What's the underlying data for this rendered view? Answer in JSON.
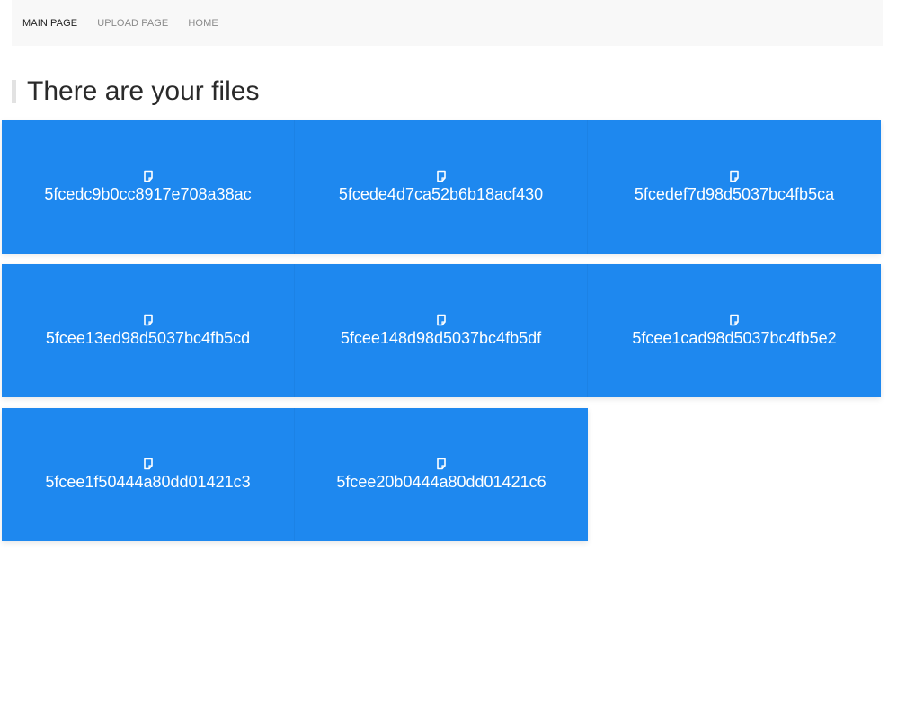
{
  "nav": {
    "items": [
      {
        "label": "MAIN PAGE",
        "active": true
      },
      {
        "label": "UPLOAD PAGE",
        "active": false
      },
      {
        "label": "HOME",
        "active": false
      }
    ]
  },
  "main": {
    "title": "There are your files"
  },
  "files": {
    "rows": [
      [
        {
          "name": "5fcedc9b0cc8917e708a38ac",
          "icon": "file-icon"
        },
        {
          "name": "5fcede4d7ca52b6b18acf430",
          "icon": "file-icon"
        },
        {
          "name": "5fcedef7d98d5037bc4fb5ca",
          "icon": "file-icon"
        }
      ],
      [
        {
          "name": "5fcee13ed98d5037bc4fb5cd",
          "icon": "file-icon"
        },
        {
          "name": "5fcee148d98d5037bc4fb5df",
          "icon": "file-icon"
        },
        {
          "name": "5fcee1cad98d5037bc4fb5e2",
          "icon": "file-icon"
        }
      ],
      [
        {
          "name": "5fcee1f50444a80dd01421c3",
          "icon": "file-icon"
        },
        {
          "name": "5fcee20b0444a80dd01421c6",
          "icon": "file-icon"
        }
      ]
    ]
  },
  "colors": {
    "tile_background": "#1e88ef",
    "navbar_background": "#f8f8f8"
  }
}
